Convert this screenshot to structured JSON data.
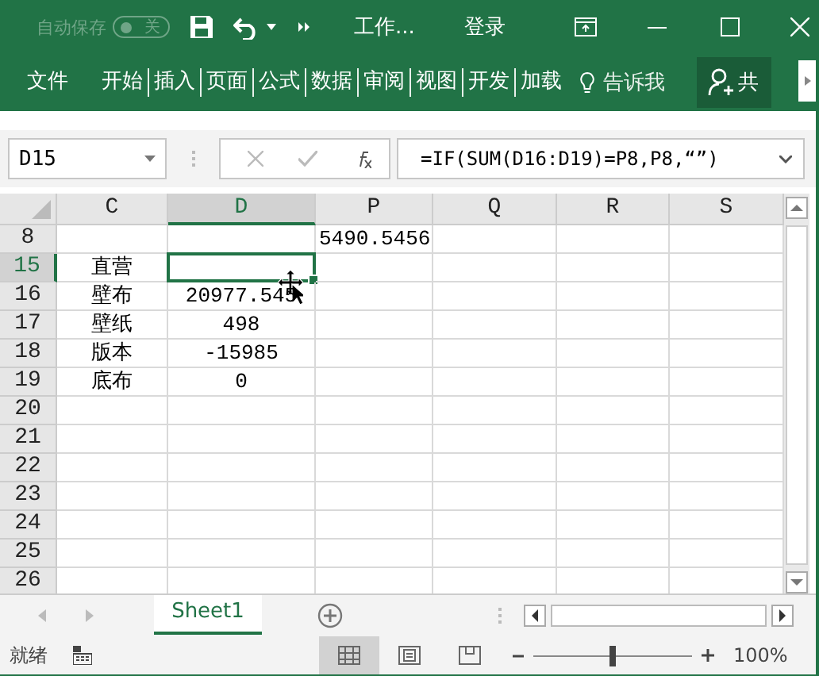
{
  "title_bar": {
    "autosave_label": "自动保存",
    "autosave_toggle": {
      "on": false,
      "label": "关"
    },
    "title": "工作...",
    "login": "登录"
  },
  "ribbon": {
    "tabs": [
      {
        "label": "文件",
        "selected": false
      },
      {
        "label": "开始",
        "selected": false
      },
      {
        "label": "插入",
        "selected": false
      },
      {
        "label": "页面",
        "selected": false
      },
      {
        "label": "公式",
        "selected": false
      },
      {
        "label": "数据",
        "selected": false
      },
      {
        "label": "审阅",
        "selected": false
      },
      {
        "label": "视图",
        "selected": false
      },
      {
        "label": "开发",
        "selected": false
      },
      {
        "label": "加载",
        "selected": false
      }
    ],
    "tell_me": "告诉我",
    "share": "共"
  },
  "formula_bar": {
    "name_box": "D15",
    "formula": "=IF(SUM(D16:D19)=P8,P8,“”)"
  },
  "grid": {
    "columns": [
      {
        "label": "C",
        "selected": false
      },
      {
        "label": "D",
        "selected": true
      },
      {
        "label": "P",
        "selected": false
      },
      {
        "label": "Q",
        "selected": false
      },
      {
        "label": "R",
        "selected": false
      },
      {
        "label": "S",
        "selected": false
      }
    ],
    "rows": [
      {
        "header": "8",
        "selected": false,
        "cells": [
          "",
          "",
          "5490.5456",
          "",
          "",
          ""
        ]
      },
      {
        "header": "15",
        "selected": true,
        "cells": [
          "直营",
          "",
          "",
          "",
          "",
          ""
        ]
      },
      {
        "header": "16",
        "selected": false,
        "cells": [
          "壁布",
          "20977.545",
          "",
          "",
          "",
          ""
        ]
      },
      {
        "header": "17",
        "selected": false,
        "cells": [
          "壁纸",
          "498",
          "",
          "",
          "",
          ""
        ]
      },
      {
        "header": "18",
        "selected": false,
        "cells": [
          "版本",
          "-15985",
          "",
          "",
          "",
          ""
        ]
      },
      {
        "header": "19",
        "selected": false,
        "cells": [
          "底布",
          "0",
          "",
          "",
          "",
          ""
        ]
      },
      {
        "header": "20",
        "selected": false,
        "cells": [
          "",
          "",
          "",
          "",
          "",
          ""
        ]
      },
      {
        "header": "21",
        "selected": false,
        "cells": [
          "",
          "",
          "",
          "",
          "",
          ""
        ]
      },
      {
        "header": "22",
        "selected": false,
        "cells": [
          "",
          "",
          "",
          "",
          "",
          ""
        ]
      },
      {
        "header": "23",
        "selected": false,
        "cells": [
          "",
          "",
          "",
          "",
          "",
          ""
        ]
      },
      {
        "header": "24",
        "selected": false,
        "cells": [
          "",
          "",
          "",
          "",
          "",
          ""
        ]
      },
      {
        "header": "25",
        "selected": false,
        "cells": [
          "",
          "",
          "",
          "",
          "",
          ""
        ]
      },
      {
        "header": "26",
        "selected": false,
        "cells": [
          "",
          "",
          "",
          "",
          "",
          ""
        ]
      }
    ]
  },
  "sheet_tabs": [
    {
      "label": "Sheet1",
      "selected": true
    }
  ],
  "status_bar": {
    "status": "就绪",
    "views": [
      {
        "kind": "normal",
        "selected": true
      },
      {
        "kind": "page-layout",
        "selected": false
      },
      {
        "kind": "page-break",
        "selected": false
      }
    ],
    "zoom": {
      "level": 0.5
    },
    "zoom_label": "100%"
  }
}
